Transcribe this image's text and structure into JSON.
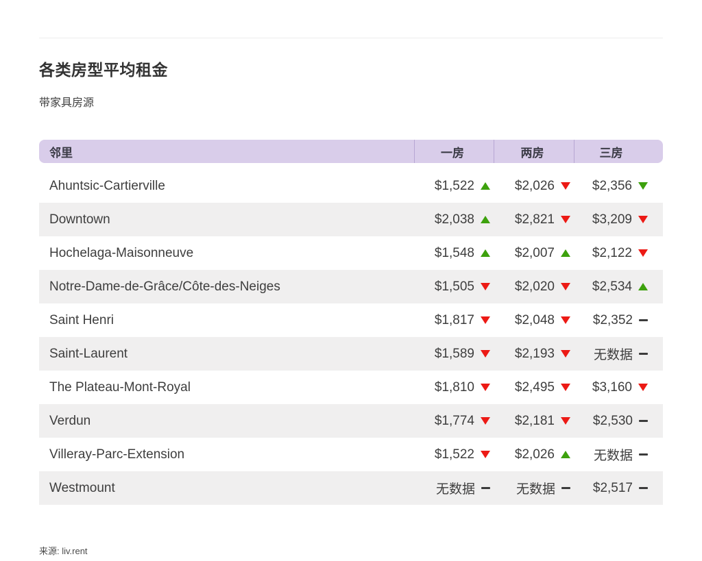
{
  "page": {
    "title": "各类房型平均租金",
    "subtitle": "带家具房源",
    "source": "来源: liv.rent"
  },
  "table": {
    "columns": [
      "邻里",
      "一房",
      "两房",
      "三房"
    ],
    "rows": [
      {
        "name": "Ahuntsic-Cartierville",
        "cells": [
          {
            "value": "$1,522",
            "dir": "up",
            "color": "green"
          },
          {
            "value": "$2,026",
            "dir": "down",
            "color": "red"
          },
          {
            "value": "$2,356",
            "dir": "down",
            "color": "green"
          }
        ]
      },
      {
        "name": "Downtown",
        "cells": [
          {
            "value": "$2,038",
            "dir": "up",
            "color": "green"
          },
          {
            "value": "$2,821",
            "dir": "down",
            "color": "red"
          },
          {
            "value": "$3,209",
            "dir": "down",
            "color": "red"
          }
        ]
      },
      {
        "name": "Hochelaga-Maisonneuve",
        "cells": [
          {
            "value": "$1,548",
            "dir": "up",
            "color": "green"
          },
          {
            "value": "$2,007",
            "dir": "up",
            "color": "green"
          },
          {
            "value": "$2,122",
            "dir": "down",
            "color": "red"
          }
        ]
      },
      {
        "name": "Notre-Dame-de-Grâce/Côte-des-Neiges",
        "cells": [
          {
            "value": "$1,505",
            "dir": "down",
            "color": "red"
          },
          {
            "value": "$2,020",
            "dir": "down",
            "color": "red"
          },
          {
            "value": "$2,534",
            "dir": "up",
            "color": "green"
          }
        ]
      },
      {
        "name": "Saint Henri",
        "cells": [
          {
            "value": "$1,817",
            "dir": "down",
            "color": "red"
          },
          {
            "value": "$2,048",
            "dir": "down",
            "color": "red"
          },
          {
            "value": "$2,352",
            "dir": "flat",
            "color": "dark"
          }
        ]
      },
      {
        "name": "Saint-Laurent",
        "cells": [
          {
            "value": "$1,589",
            "dir": "down",
            "color": "red"
          },
          {
            "value": "$2,193",
            "dir": "down",
            "color": "red"
          },
          {
            "value": "无数据",
            "dir": "flat",
            "color": "dark"
          }
        ]
      },
      {
        "name": "The Plateau-Mont-Royal",
        "cells": [
          {
            "value": "$1,810",
            "dir": "down",
            "color": "red"
          },
          {
            "value": "$2,495",
            "dir": "down",
            "color": "red"
          },
          {
            "value": "$3,160",
            "dir": "down",
            "color": "red"
          }
        ]
      },
      {
        "name": "Verdun",
        "cells": [
          {
            "value": "$1,774",
            "dir": "down",
            "color": "red"
          },
          {
            "value": "$2,181",
            "dir": "down",
            "color": "red"
          },
          {
            "value": "$2,530",
            "dir": "flat",
            "color": "dark"
          }
        ]
      },
      {
        "name": "Villeray-Parc-Extension",
        "cells": [
          {
            "value": "$1,522",
            "dir": "down",
            "color": "red"
          },
          {
            "value": "$2,026",
            "dir": "up",
            "color": "green"
          },
          {
            "value": "无数据",
            "dir": "flat",
            "color": "dark"
          }
        ]
      },
      {
        "name": "Westmount",
        "cells": [
          {
            "value": "无数据",
            "dir": "flat",
            "color": "dark"
          },
          {
            "value": "无数据",
            "dir": "flat",
            "color": "dark"
          },
          {
            "value": "$2,517",
            "dir": "flat",
            "color": "dark"
          }
        ]
      }
    ]
  },
  "colors": {
    "header_bg": "#d9cdea",
    "header_divider": "#b7a6d3",
    "stripe_gray": "#f0efef",
    "trend_green": "#3da10d",
    "trend_red": "#ec1a15",
    "trend_flat": "#3b3b3b",
    "text": "#3e3e3e"
  }
}
